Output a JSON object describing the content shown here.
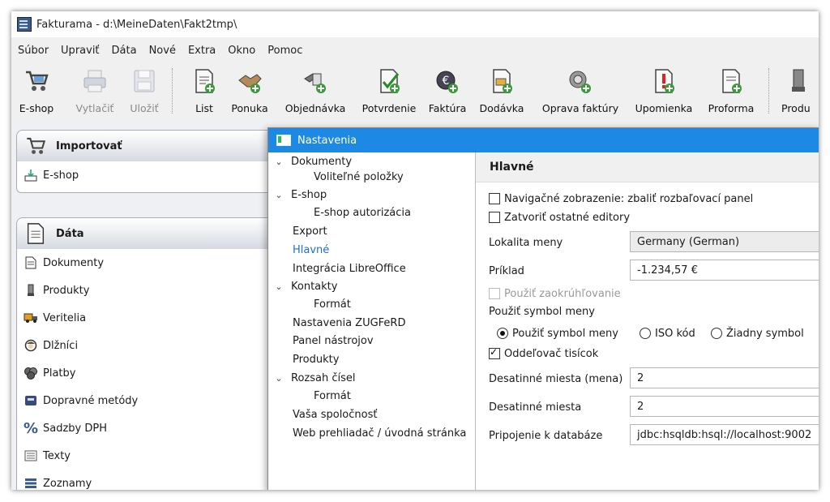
{
  "window": {
    "title": "Fakturama - d:\\MeineDaten\\Fakt2tmp\\"
  },
  "menu": [
    "Súbor",
    "Upraviť",
    "Dáta",
    "Nové",
    "Extra",
    "Okno",
    "Pomoc"
  ],
  "toolbar": {
    "eshop": "E-shop",
    "print": "Vytlačiť",
    "save": "Uložiť",
    "letter": "List",
    "offer": "Ponuka",
    "order": "Objednávka",
    "confirmation": "Potvrdenie",
    "invoice": "Faktúra",
    "delivery": "Dodávka",
    "credit": "Oprava faktúry",
    "dunning": "Upomienka",
    "proforma": "Proforma",
    "product": "Produ"
  },
  "left": {
    "import_title": "Importovať",
    "import_items": [
      "E-shop"
    ],
    "data_title": "Dáta",
    "data_items": [
      "Dokumenty",
      "Produkty",
      "Veritelia",
      "Dlžníci",
      "Platby",
      "Dopravné metódy",
      "Sadzby DPH",
      "Texty",
      "Zoznamy"
    ]
  },
  "dialog": {
    "title": "Nastavenia",
    "tree": [
      {
        "label": "Dokumenty",
        "expanded": true
      },
      {
        "label": "Voliteľné položky"
      },
      {
        "label": "E-shop",
        "expanded": true
      },
      {
        "label": "E-shop autorizácia"
      },
      {
        "label": "Export"
      },
      {
        "label": "Hlavné",
        "selected": true
      },
      {
        "label": "Integrácia LibreOffice"
      },
      {
        "label": "Kontakty",
        "expanded": true
      },
      {
        "label": "Formát"
      },
      {
        "label": "Nastavenia ZUGFeRD"
      },
      {
        "label": "Panel nástrojov"
      },
      {
        "label": "Produkty"
      },
      {
        "label": "Rozsah čísel",
        "expanded": true
      },
      {
        "label": "Formát"
      },
      {
        "label": "Vaša spoločnosť"
      },
      {
        "label": "Web prehliadač / úvodná stránka"
      }
    ],
    "section_title": "Hlavné",
    "opt_navigation": "Navigačné zobrazenie: zbaliť rozbaľovací panel",
    "opt_close_editors": "Zatvoriť ostatné editory",
    "locale_label": "Lokalita meny",
    "locale_value": "Germany (German)",
    "example_label": "Príklad",
    "example_value": "-1.234,57 €",
    "rounding_label": "Použiť zaokrúhľovanie",
    "currency_symbol_label": "Použiť symbol meny",
    "radio_symbol": "Použiť symbol meny",
    "radio_iso": "ISO kód",
    "radio_none": "Žiadny symbol",
    "thousands_label": "Oddeľovač tisícok",
    "decimals_currency_label": "Desatinné miesta (mena)",
    "decimals_currency_value": "2",
    "decimals_label": "Desatinné miesta",
    "decimals_value": "2",
    "db_label": "Pripojenie k databáze",
    "db_value": "jdbc:hsqldb:hsql://localhost:9002"
  },
  "colors": {
    "accent": "#1e88e5",
    "selected_text": "#1e6fd9"
  }
}
